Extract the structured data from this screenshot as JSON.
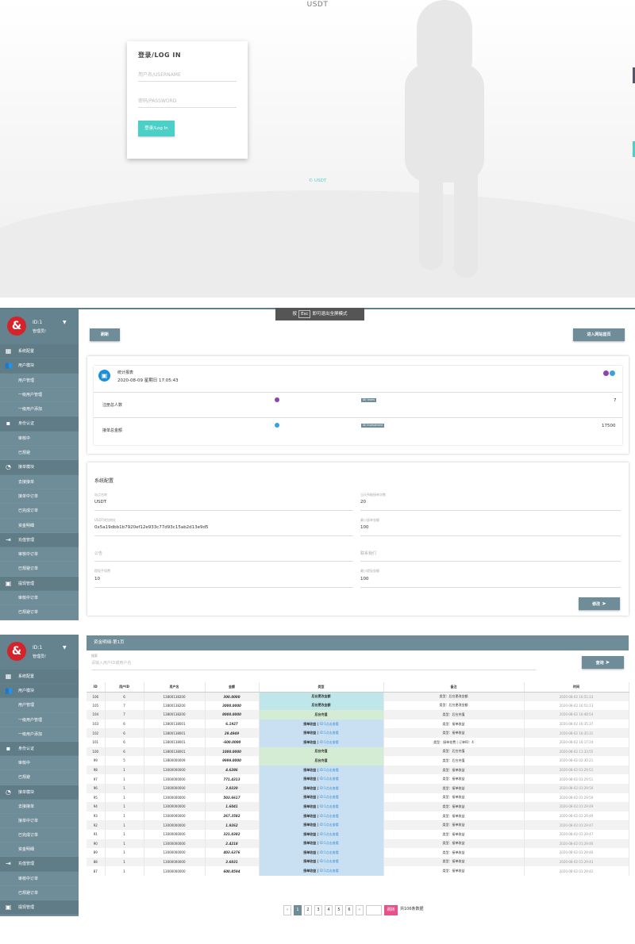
{
  "login": {
    "site_title": "USDT",
    "card_title": "登录/LOG IN",
    "username_placeholder": "用户名/USERNAME",
    "password_placeholder": "密码/PASSWORD",
    "login_button": "登录/Log In",
    "copyright": "© USDT"
  },
  "sidebar": {
    "user_id": "ID:1",
    "user_role": "管理员!",
    "items": [
      {
        "label": "系统配置",
        "group": true,
        "icon": "dashboard-icon"
      },
      {
        "label": "用户模块",
        "group": true,
        "icon": "users-icon"
      },
      {
        "label": "用户管理",
        "group": false
      },
      {
        "label": "一级用户管理",
        "group": false
      },
      {
        "label": "一级用户添加",
        "group": false
      },
      {
        "label": "身份认证",
        "group": true,
        "icon": "id-card-icon"
      },
      {
        "label": "审核中",
        "group": false
      },
      {
        "label": "已规避",
        "group": false
      },
      {
        "label": "接单模块",
        "group": true,
        "icon": "pie-icon"
      },
      {
        "label": "去接接单",
        "group": false
      },
      {
        "label": "接单中订单",
        "group": false
      },
      {
        "label": "已完成订单",
        "group": false
      },
      {
        "label": "资金明细",
        "group": false
      },
      {
        "label": "充值管理",
        "group": true,
        "icon": "sign-in-icon"
      },
      {
        "label": "审核中订单",
        "group": false
      },
      {
        "label": "已规避订单",
        "group": false
      },
      {
        "label": "提现管理",
        "group": true,
        "icon": "card-icon"
      },
      {
        "label": "审核中订单",
        "group": false
      },
      {
        "label": "已规避订单",
        "group": false
      }
    ]
  },
  "fullscreen_bar": {
    "pre": "按",
    "key": "Esc",
    "post": "即可退出全屏模式"
  },
  "dashboard": {
    "refresh_button": "刷新",
    "enter_site_button": "进入网站首页",
    "stats_title": "统计报表",
    "stats_time": "2020-08-09   星期日 17:05:43",
    "rows": [
      {
        "label": "注册总人数",
        "tag": "All Users",
        "value": "7"
      },
      {
        "label": "接单总金额",
        "tag": "All Investment",
        "value": "17500"
      }
    ],
    "config_title": "系统配置",
    "fields": [
      {
        "label": "站点名称",
        "value": "USDT"
      },
      {
        "label": "当天所能接单次数",
        "value": "20"
      },
      {
        "label": "USDT钱包地址",
        "value": "0x5a19dbb1b7920ef12e933c77d93c15ab2d13e9d5"
      },
      {
        "label": "最小接单金额",
        "value": "100"
      },
      {
        "label": "公告",
        "value": ""
      },
      {
        "label": "联系我们",
        "value": ""
      },
      {
        "label": "提现手续费",
        "value": "10"
      },
      {
        "label": "最小提现金额",
        "value": "100"
      }
    ],
    "save_button": "修改"
  },
  "ledger": {
    "header": "资金明细-第1页",
    "search_label": "搜索",
    "search_placeholder": "请输入用户ID或用户名",
    "search_button": "查询",
    "columns": [
      "ID",
      "用户ID",
      "用户名",
      "金额",
      "类型",
      "备注",
      "时间"
    ],
    "rows": [
      {
        "id": "106",
        "uid": "6",
        "name": "13800138200",
        "amount": "300.0000",
        "type": "后台更改金额",
        "link": "",
        "note": "类型：后台更改金额",
        "time": "2020-08-02 16:51:33",
        "bg": "#bfe6e8"
      },
      {
        "id": "105",
        "uid": "7",
        "name": "13800138200",
        "amount": "3000.0000",
        "type": "后台更改金额",
        "link": "",
        "note": "类型：后台更改金额",
        "time": "2020-08-02 16:51:13",
        "bg": "#bfe6e8"
      },
      {
        "id": "104",
        "uid": "7",
        "name": "13800138200",
        "amount": "8000.0000",
        "type": "后台充值",
        "link": "",
        "note": "类型：后台充值",
        "time": "2020-08-02 16:48:54",
        "bg": "#d3ecd3"
      },
      {
        "id": "103",
        "uid": "6",
        "name": "13800138001",
        "amount": "6.1927",
        "type": "接单收益",
        "link": "ID:1点击查看",
        "note": "类型：接单收益",
        "time": "2020-08-02 16:35:37",
        "bg": "#c9dff2"
      },
      {
        "id": "102",
        "uid": "6",
        "name": "13800138001",
        "amount": "29.4949",
        "type": "接单收益",
        "link": "ID:1点击查看",
        "note": "类型：接单收益",
        "time": "2020-08-02 16:35:31",
        "bg": "#c9dff2"
      },
      {
        "id": "101",
        "uid": "6",
        "name": "13800138001",
        "amount": "-600.0000",
        "type": "接单收益",
        "link": "ID:1点击查看",
        "note": "类型：接单花费 | 订单ID：4",
        "time": "2020-08-02 16:17:24",
        "bg": "#c9dff2"
      },
      {
        "id": "100",
        "uid": "6",
        "name": "13800138001",
        "amount": "1000.0000",
        "type": "后台充值",
        "link": "",
        "note": "类型：后台充值",
        "time": "2020-08-02 11:33:55",
        "bg": "#d3ecd3"
      },
      {
        "id": "99",
        "uid": "5",
        "name": "13800000009",
        "amount": "9999.0000",
        "type": "后台充值",
        "link": "",
        "note": "类型：后台充值",
        "time": "2020-08-02 02:30:21",
        "bg": "#d3ecd3"
      },
      {
        "id": "98",
        "uid": "1",
        "name": "13000000000",
        "amount": "4.6286",
        "type": "接单收益",
        "link": "ID:1点击查看",
        "note": "类型：接单收益",
        "time": "2020-08-02 01:29:51",
        "bg": "#c9dff2"
      },
      {
        "id": "97",
        "uid": "1",
        "name": "13000000000",
        "amount": "771.4313",
        "type": "接单收益",
        "link": "ID:1点击查看",
        "note": "类型：接单收益",
        "time": "2020-08-02 01:29:51",
        "bg": "#c9dff2"
      },
      {
        "id": "96",
        "uid": "1",
        "name": "13000000000",
        "amount": "3.0220",
        "type": "接单收益",
        "link": "ID:1点击查看",
        "note": "类型：接单收益",
        "time": "2020-08-02 01:29:50",
        "bg": "#c9dff2"
      },
      {
        "id": "95",
        "uid": "1",
        "name": "13000000000",
        "amount": "503.6617",
        "type": "接单收益",
        "link": "ID:1点击查看",
        "note": "类型：接单收益",
        "time": "2020-08-02 01:29:50",
        "bg": "#c9dff2"
      },
      {
        "id": "94",
        "uid": "1",
        "name": "13000000000",
        "amount": "1.6041",
        "type": "接单收益",
        "link": "ID:1点击查看",
        "note": "类型：接单收益",
        "time": "2020-08-02 01:29:49",
        "bg": "#c9dff2"
      },
      {
        "id": "93",
        "uid": "1",
        "name": "13000000000",
        "amount": "267.3582",
        "type": "接单收益",
        "link": "ID:1点击查看",
        "note": "类型：接单收益",
        "time": "2020-08-02 01:29:49",
        "bg": "#c9dff2"
      },
      {
        "id": "92",
        "uid": "1",
        "name": "13000000000",
        "amount": "1.9262",
        "type": "接单收益",
        "link": "ID:1点击查看",
        "note": "类型：接单收益",
        "time": "2020-08-02 01:29:47",
        "bg": "#c9dff2"
      },
      {
        "id": "91",
        "uid": "1",
        "name": "13000000000",
        "amount": "321.0382",
        "type": "接单收益",
        "link": "ID:1点击查看",
        "note": "类型：接单收益",
        "time": "2020-08-02 01:29:47",
        "bg": "#c9dff2"
      },
      {
        "id": "90",
        "uid": "1",
        "name": "13000000000",
        "amount": "2.4218",
        "type": "接单收益",
        "link": "ID:1点击查看",
        "note": "类型：接单收益",
        "time": "2020-08-02 01:29:46",
        "bg": "#c9dff2"
      },
      {
        "id": "89",
        "uid": "1",
        "name": "13000000000",
        "amount": "403.6376",
        "type": "接单收益",
        "link": "ID:1点击查看",
        "note": "类型：接单收益",
        "time": "2020-08-02 01:29:46",
        "bg": "#c9dff2"
      },
      {
        "id": "88",
        "uid": "1",
        "name": "13000000000",
        "amount": "3.6031",
        "type": "接单收益",
        "link": "ID:1点击查看",
        "note": "类型：接单收益",
        "time": "2020-08-02 01:29:43",
        "bg": "#c9dff2"
      },
      {
        "id": "87",
        "uid": "1",
        "name": "13000000000",
        "amount": "600.8594",
        "type": "接单收益",
        "link": "ID:1点击查看",
        "note": "类型：接单收益",
        "time": "2020-08-02 01:29:42",
        "bg": "#c9dff2"
      }
    ],
    "pagination": {
      "prev": "‹",
      "pages": [
        "1",
        "2",
        "3",
        "4",
        "5",
        "6"
      ],
      "next": "›",
      "goto_button": "跳转",
      "total": "共106条数据"
    }
  },
  "colors": {
    "accent": "#4ccfc6",
    "sidebar": "#6e8d98",
    "logo": "#d4232a"
  }
}
